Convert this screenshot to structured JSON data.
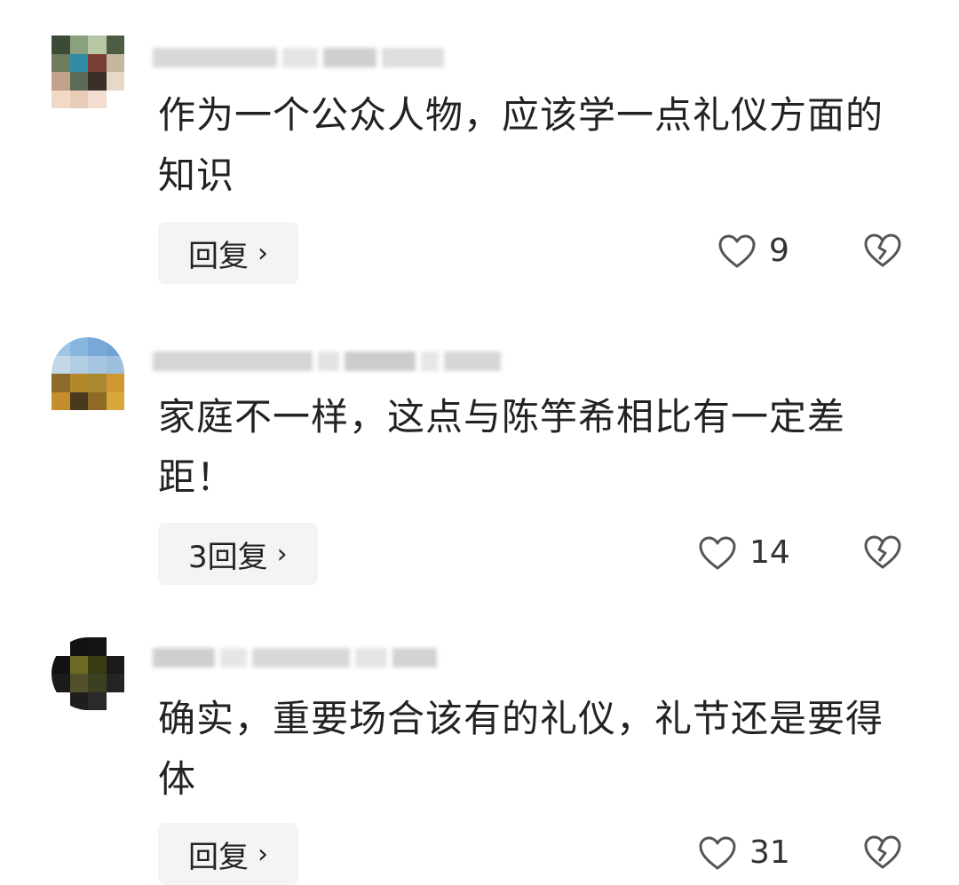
{
  "comments": [
    {
      "text": "作为一个公众人物，应该学一点礼仪方面的知识",
      "reply_label": "回复",
      "reply_chevron": "›",
      "likes": "9",
      "avatar_colors": [
        "#3c4a37",
        "#8ba07e",
        "#b7c7a3",
        "#4f5c44",
        "#6f7b5e",
        "#2f8ca3",
        "#7a3d34",
        "#c4b8a0",
        "#c1a18a",
        "#5b6b58",
        "#3b2f2a",
        "#e8d8c8",
        "#f1d9c8",
        "#e7cdb7",
        "#f2ddd0",
        "#ffffff"
      ]
    },
    {
      "text": "家庭不一样，这点与陈竽希相比有一定差距！",
      "reply_label": "3回复",
      "reply_chevron": "›",
      "likes": "14",
      "avatar_colors": [
        "#9fc4e4",
        "#86b5de",
        "#77a9d8",
        "#6ea3d6",
        "#c3d7e6",
        "#b0cde3",
        "#a6c5e0",
        "#9cbfdc",
        "#8c6a2b",
        "#b5872c",
        "#a9882f",
        "#cf9a35",
        "#c58d2b",
        "#4a3a1d",
        "#8f6a26",
        "#d9a63c"
      ]
    },
    {
      "text": "确实，重要场合该有的礼仪，礼节还是要得体",
      "reply_label": "回复",
      "reply_chevron": "›",
      "likes": "31",
      "avatar_colors": [
        "#ffffff",
        "#111111",
        "#151515",
        "#ffffff",
        "#121212",
        "#6b6b24",
        "#3a3a14",
        "#1a1a1a",
        "#1b1b1b",
        "#52512a",
        "#3c4020",
        "#242424",
        "#ffffff",
        "#1e1e1e",
        "#2a2a2a",
        "#ffffff"
      ]
    }
  ]
}
